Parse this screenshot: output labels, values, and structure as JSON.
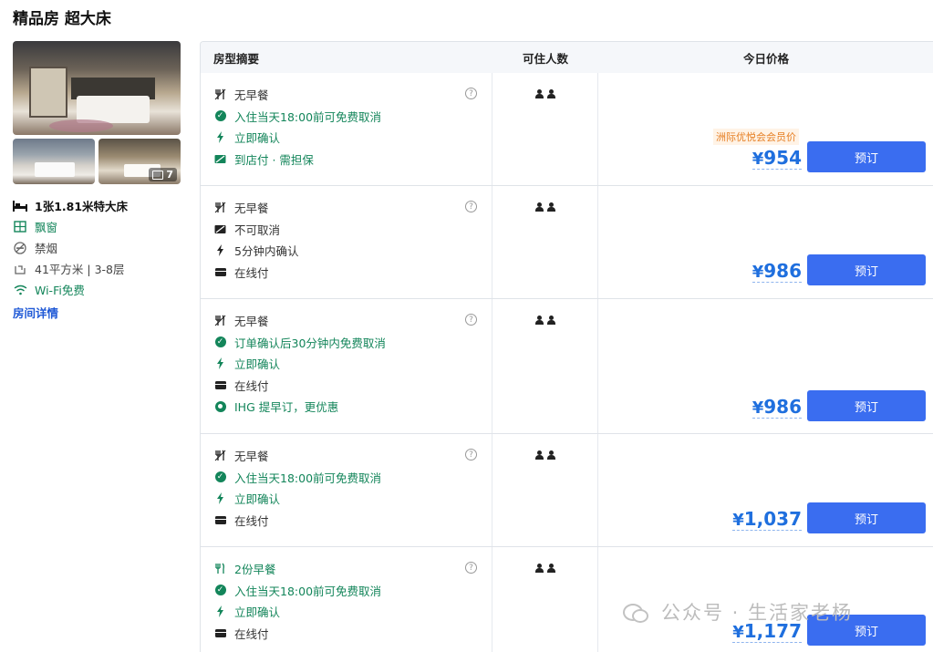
{
  "room_title": "精品房 超大床",
  "photos": {
    "count": "7"
  },
  "facts": {
    "bed": "1张1.81米特大床",
    "window": "飘窗",
    "smoking": "禁烟",
    "size_floor": "41平方米 | 3-8层",
    "wifi": "Wi-Fi免费",
    "details_link": "房间详情"
  },
  "table": {
    "headers": {
      "summary": "房型摘要",
      "guests": "可住人数",
      "price": "今日价格"
    }
  },
  "rows": [
    {
      "items": [
        {
          "text": "无早餐",
          "icon": "no-breakfast-icon",
          "green": false
        },
        {
          "text": "入住当天18:00前可免费取消",
          "icon": "check-circle-icon",
          "green": true
        },
        {
          "text": "立即确认",
          "icon": "bolt-icon",
          "green": true
        },
        {
          "text": "到店付 · 需担保",
          "icon": "pay-at-hotel-icon",
          "green": true
        }
      ],
      "tag": "洲际优悦会会员价",
      "price": "954",
      "book": "预订"
    },
    {
      "items": [
        {
          "text": "无早餐",
          "icon": "no-breakfast-icon",
          "green": false
        },
        {
          "text": "不可取消",
          "icon": "no-cancel-icon",
          "green": false
        },
        {
          "text": "5分钟内确认",
          "icon": "bolt-icon",
          "green": false
        },
        {
          "text": "在线付",
          "icon": "card-icon",
          "green": false
        }
      ],
      "price": "986",
      "book": "预订"
    },
    {
      "items": [
        {
          "text": "无早餐",
          "icon": "no-breakfast-icon",
          "green": false
        },
        {
          "text": "订单确认后30分钟内免费取消",
          "icon": "check-circle-icon",
          "green": true
        },
        {
          "text": "立即确认",
          "icon": "bolt-icon",
          "green": true
        },
        {
          "text": "在线付",
          "icon": "card-icon",
          "green": false
        },
        {
          "text": "IHG 提早订，更优惠",
          "icon": "dot-circle-icon",
          "green": true
        }
      ],
      "price": "986",
      "book": "预订"
    },
    {
      "items": [
        {
          "text": "无早餐",
          "icon": "no-breakfast-icon",
          "green": false
        },
        {
          "text": "入住当天18:00前可免费取消",
          "icon": "check-circle-icon",
          "green": true
        },
        {
          "text": "立即确认",
          "icon": "bolt-icon",
          "green": true
        },
        {
          "text": "在线付",
          "icon": "card-icon",
          "green": false
        }
      ],
      "price": "1,037",
      "book": "预订"
    },
    {
      "items": [
        {
          "text": "2份早餐",
          "icon": "breakfast-icon",
          "green": true
        },
        {
          "text": "入住当天18:00前可免费取消",
          "icon": "check-circle-icon",
          "green": true
        },
        {
          "text": "立即确认",
          "icon": "bolt-icon",
          "green": true
        },
        {
          "text": "在线付",
          "icon": "card-icon",
          "green": false
        }
      ],
      "price": "1,177",
      "book": "预订"
    }
  ],
  "watermark": "公众号 · 生活家老杨",
  "colors": {
    "accent": "#3a6df0",
    "price": "#1f6fde",
    "green": "#13855a",
    "member_tag": "#e67e22"
  }
}
